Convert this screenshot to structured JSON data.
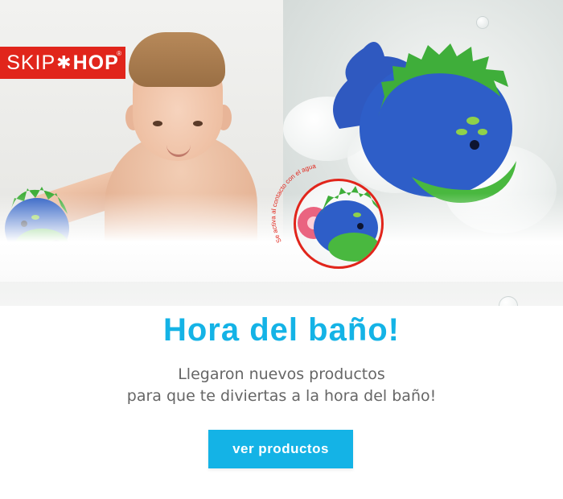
{
  "brand": {
    "logo_left": "SKIP",
    "logo_star": "✱",
    "logo_right": "HOP",
    "logo_reg": "®",
    "logo_color": "#e1251b"
  },
  "inset": {
    "caption": "Se activa al contacto con el agua",
    "border_color": "#e1251b"
  },
  "hero": {
    "headline": "Hora del baño!",
    "headline_color": "#14b3e6",
    "subtitle_line1": "Llegaron nuevos productos",
    "subtitle_line2": "para que te diviertas a la hora del baño!"
  },
  "cta": {
    "label": "ver productos",
    "color": "#14b3e6"
  },
  "icons": {
    "toy": "dinosaur-icon",
    "bubble": "bubble-icon"
  }
}
